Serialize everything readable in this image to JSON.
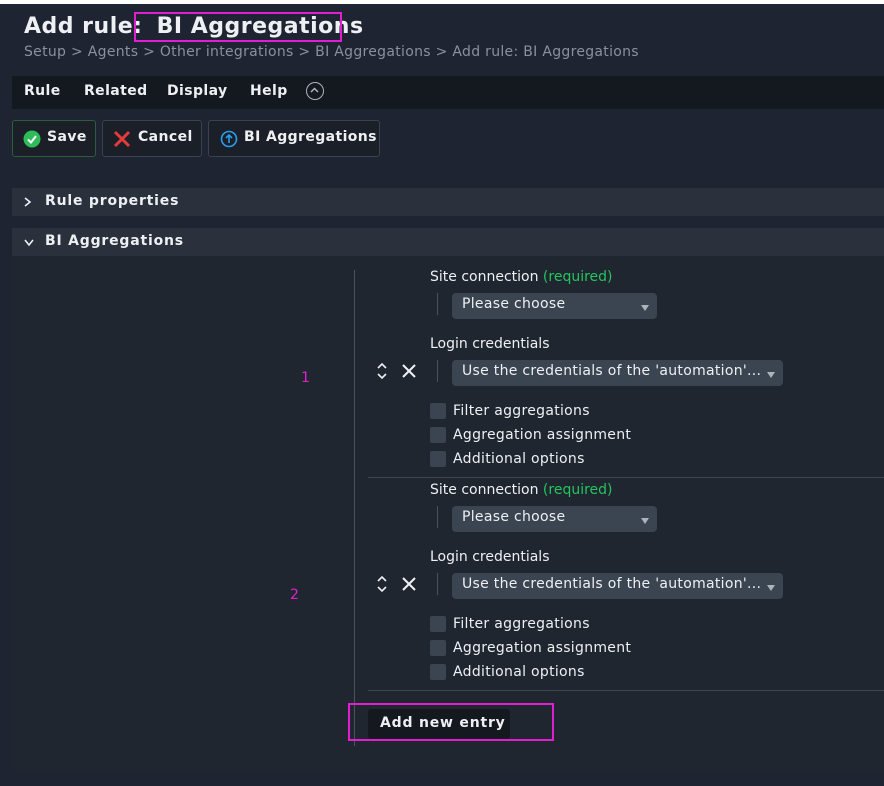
{
  "page": {
    "title_prefix": "Add rule:",
    "title_name": "BI Aggregations",
    "breadcrumb": "Setup > Agents > Other integrations > BI Aggregations > Add rule: BI Aggregations"
  },
  "menu": {
    "items": [
      "Rule",
      "Related",
      "Display",
      "Help"
    ]
  },
  "toolbar": {
    "save": "Save",
    "cancel": "Cancel",
    "parent": "BI Aggregations"
  },
  "sections": {
    "rule_properties": "Rule properties",
    "bi_aggregations": "BI Aggregations"
  },
  "entries": [
    {
      "index": "1",
      "site_connection_label": "Site connection",
      "required": "(required)",
      "site_connection_value": "Please choose",
      "login_label": "Login credentials",
      "login_value": "Use the credentials of the 'automation'...",
      "checkboxes": [
        "Filter aggregations",
        "Aggregation assignment",
        "Additional options"
      ]
    },
    {
      "index": "2",
      "site_connection_label": "Site connection",
      "required": "(required)",
      "site_connection_value": "Please choose",
      "login_label": "Login credentials",
      "login_value": "Use the credentials of the 'automation'...",
      "checkboxes": [
        "Filter aggregations",
        "Aggregation assignment",
        "Additional options"
      ]
    }
  ],
  "add_entry": "Add new entry",
  "icons": {
    "save": "check-circle-icon",
    "cancel": "red-x-icon",
    "parent": "up-arrow-circle-icon",
    "menu_toggle": "chevron-up-circle-icon",
    "move": "sort-arrows-icon",
    "delete": "close-icon"
  },
  "colors": {
    "background": "#1e2431",
    "menubar": "#14181f",
    "section_header": "#2a313d",
    "required": "#23c45e",
    "highlight": "#e020d0",
    "save_green": "#2fbb5a",
    "cancel_red": "#e43b3b",
    "parent_blue": "#2b9ef0"
  }
}
